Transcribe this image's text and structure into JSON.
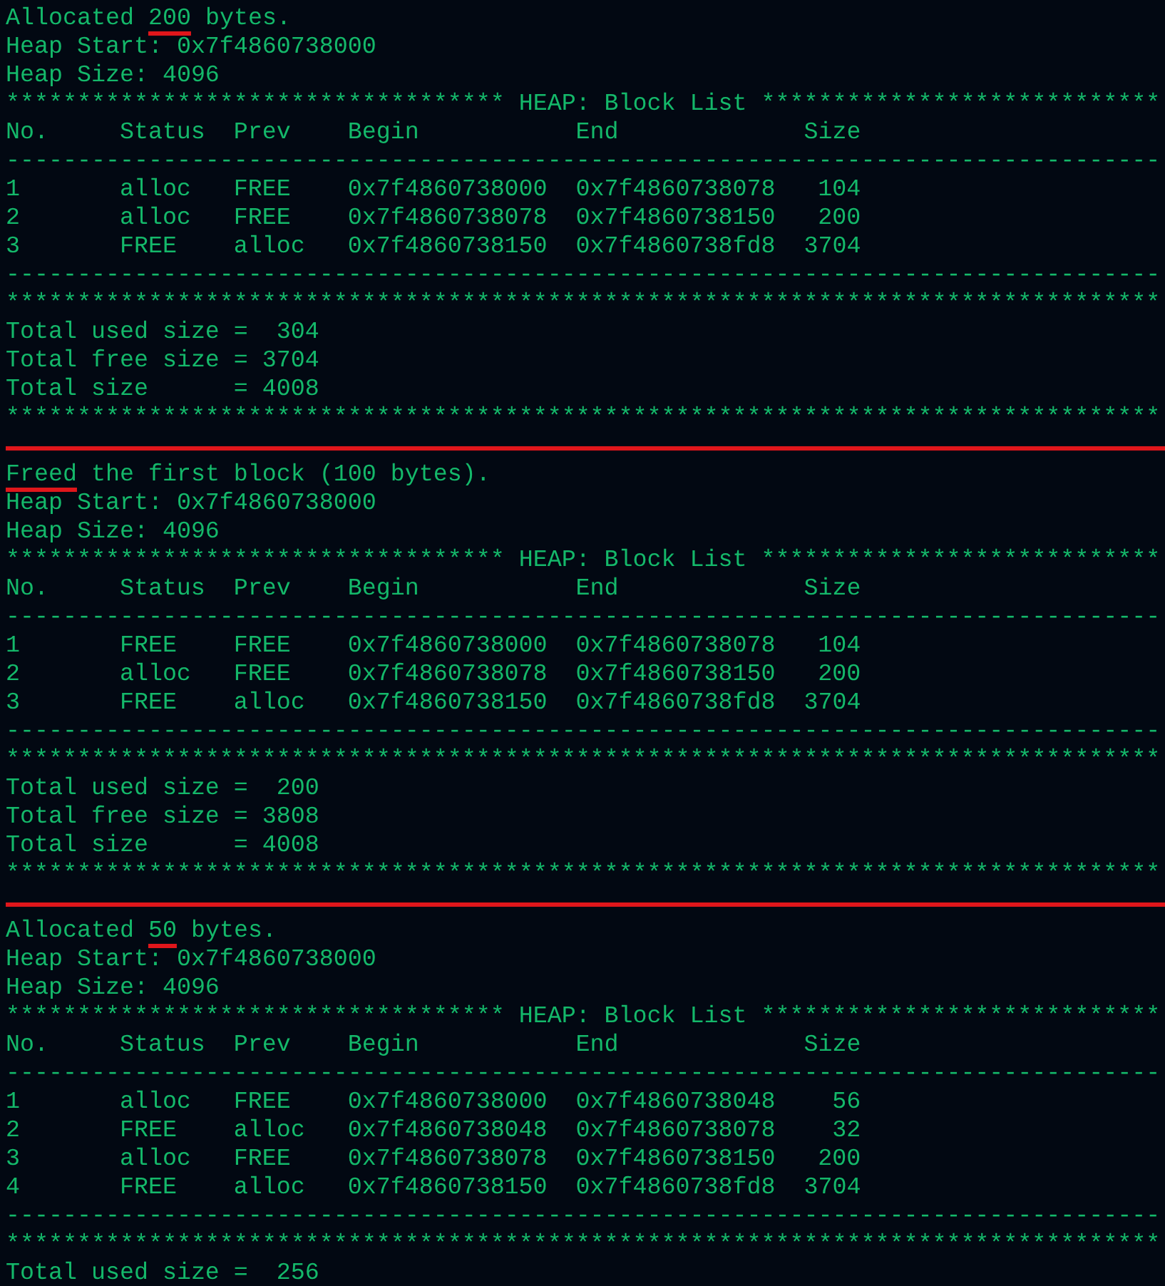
{
  "sections": [
    {
      "message": [
        {
          "text": "Allocated ",
          "underlined": false
        },
        {
          "text": "200",
          "underlined": true
        },
        {
          "text": " bytes.",
          "underlined": false
        }
      ],
      "heap_start": "Heap Start: 0x7f4860738000",
      "heap_size": "Heap Size: 4096",
      "list_title": "*********************************** HEAP: Block List ****************************",
      "columns": [
        "No.",
        "Status",
        "Prev",
        "Begin",
        "End",
        "Size"
      ],
      "dash_rule_top": "---------------------------------------------------------------------------------",
      "rows": [
        {
          "cells": [
            "1",
            "alloc",
            "FREE",
            "0x7f4860738000",
            "0x7f4860738078",
            "104"
          ]
        },
        {
          "cells": [
            "2",
            "alloc",
            "FREE",
            "0x7f4860738078",
            "0x7f4860738150",
            "200"
          ]
        },
        {
          "cells": [
            "3",
            "FREE",
            "alloc",
            "0x7f4860738150",
            "0x7f4860738fd8",
            "3704"
          ]
        }
      ],
      "dash_rule_bottom": "---------------------------------------------------------------------------------",
      "star_rule": "*********************************************************************************",
      "totals": [
        "Total used size =  304",
        "Total free size = 3704",
        "Total size      = 4008"
      ],
      "star_rule_end": "*********************************************************************************",
      "separator": true
    },
    {
      "message": [
        {
          "text": "Freed",
          "underlined": true
        },
        {
          "text": " the first block (100 bytes).",
          "underlined": false
        }
      ],
      "heap_start": "Heap Start: 0x7f4860738000",
      "heap_size": "Heap Size: 4096",
      "list_title": "*********************************** HEAP: Block List ****************************",
      "columns": [
        "No.",
        "Status",
        "Prev",
        "Begin",
        "End",
        "Size"
      ],
      "dash_rule_top": "---------------------------------------------------------------------------------",
      "rows": [
        {
          "cells": [
            "1",
            "FREE",
            "FREE",
            "0x7f4860738000",
            "0x7f4860738078",
            "104"
          ]
        },
        {
          "cells": [
            "2",
            "alloc",
            "FREE",
            "0x7f4860738078",
            "0x7f4860738150",
            "200"
          ]
        },
        {
          "cells": [
            "3",
            "FREE",
            "alloc",
            "0x7f4860738150",
            "0x7f4860738fd8",
            "3704"
          ]
        }
      ],
      "dash_rule_bottom": "---------------------------------------------------------------------------------",
      "star_rule": "*********************************************************************************",
      "totals": [
        "Total used size =  200",
        "Total free size = 3808",
        "Total size      = 4008"
      ],
      "star_rule_end": "*********************************************************************************",
      "separator": true
    },
    {
      "message": [
        {
          "text": "Allocated ",
          "underlined": false
        },
        {
          "text": "50",
          "underlined": true
        },
        {
          "text": " bytes.",
          "underlined": false
        }
      ],
      "heap_start": "Heap Start: 0x7f4860738000",
      "heap_size": "Heap Size: 4096",
      "list_title": "*********************************** HEAP: Block List ****************************",
      "columns": [
        "No.",
        "Status",
        "Prev",
        "Begin",
        "End",
        "Size"
      ],
      "dash_rule_top": "---------------------------------------------------------------------------------",
      "rows": [
        {
          "cells": [
            "1",
            "alloc",
            "FREE",
            "0x7f4860738000",
            "0x7f4860738048",
            "56"
          ]
        },
        {
          "cells": [
            "2",
            "FREE",
            "alloc",
            "0x7f4860738048",
            "0x7f4860738078",
            "32"
          ]
        },
        {
          "cells": [
            "3",
            "alloc",
            "FREE",
            "0x7f4860738078",
            "0x7f4860738150",
            "200"
          ]
        },
        {
          "cells": [
            "4",
            "FREE",
            "alloc",
            "0x7f4860738150",
            "0x7f4860738fd8",
            "3704"
          ]
        }
      ],
      "dash_rule_bottom": "---------------------------------------------------------------------------------",
      "star_rule": "*********************************************************************************",
      "totals": [
        "Total used size =  256"
      ],
      "separator": false
    }
  ]
}
